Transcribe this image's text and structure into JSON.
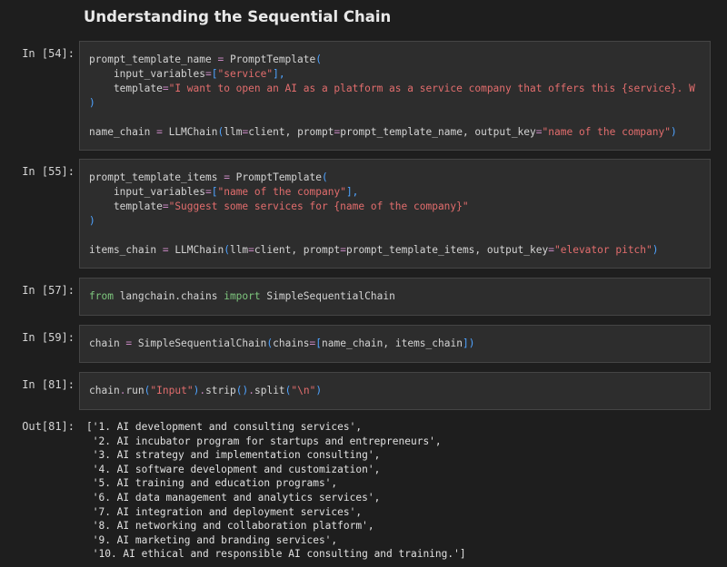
{
  "notebook": {
    "heading": "Understanding the Sequential Chain",
    "cells": [
      {
        "prompt": "In [54]:",
        "lines": [
          [
            {
              "t": "prompt_template_name ",
              "c": "id"
            },
            {
              "t": "=",
              "c": "op"
            },
            {
              "t": " PromptTemplate",
              "c": "id"
            },
            {
              "t": "(",
              "c": "br"
            }
          ],
          [
            {
              "t": "    input_variables",
              "c": "id"
            },
            {
              "t": "=",
              "c": "op"
            },
            {
              "t": "[",
              "c": "br"
            },
            {
              "t": "\"service\"",
              "c": "str"
            },
            {
              "t": "],",
              "c": "br"
            }
          ],
          [
            {
              "t": "    template",
              "c": "id"
            },
            {
              "t": "=",
              "c": "op"
            },
            {
              "t": "\"I want to open an AI as a platform as a service company that offers this {service}. W",
              "c": "str"
            }
          ],
          [
            {
              "t": ")",
              "c": "br"
            }
          ],
          [],
          [
            {
              "t": "name_chain ",
              "c": "id"
            },
            {
              "t": "=",
              "c": "op"
            },
            {
              "t": " LLMChain",
              "c": "id"
            },
            {
              "t": "(",
              "c": "br"
            },
            {
              "t": "llm",
              "c": "id"
            },
            {
              "t": "=",
              "c": "op"
            },
            {
              "t": "client, prompt",
              "c": "id"
            },
            {
              "t": "=",
              "c": "op"
            },
            {
              "t": "prompt_template_name, output_key",
              "c": "id"
            },
            {
              "t": "=",
              "c": "op"
            },
            {
              "t": "\"name of the company\"",
              "c": "str"
            },
            {
              "t": ")",
              "c": "br"
            }
          ]
        ]
      },
      {
        "prompt": "In [55]:",
        "lines": [
          [
            {
              "t": "prompt_template_items ",
              "c": "id"
            },
            {
              "t": "=",
              "c": "op"
            },
            {
              "t": " PromptTemplate",
              "c": "id"
            },
            {
              "t": "(",
              "c": "br"
            }
          ],
          [
            {
              "t": "    input_variables",
              "c": "id"
            },
            {
              "t": "=",
              "c": "op"
            },
            {
              "t": "[",
              "c": "br"
            },
            {
              "t": "\"name of the company\"",
              "c": "str"
            },
            {
              "t": "],",
              "c": "br"
            }
          ],
          [
            {
              "t": "    template",
              "c": "id"
            },
            {
              "t": "=",
              "c": "op"
            },
            {
              "t": "\"Suggest some services for {name of the company}\"",
              "c": "str"
            }
          ],
          [
            {
              "t": ")",
              "c": "br"
            }
          ],
          [],
          [
            {
              "t": "items_chain ",
              "c": "id"
            },
            {
              "t": "=",
              "c": "op"
            },
            {
              "t": " LLMChain",
              "c": "id"
            },
            {
              "t": "(",
              "c": "br"
            },
            {
              "t": "llm",
              "c": "id"
            },
            {
              "t": "=",
              "c": "op"
            },
            {
              "t": "client, prompt",
              "c": "id"
            },
            {
              "t": "=",
              "c": "op"
            },
            {
              "t": "prompt_template_items, output_key",
              "c": "id"
            },
            {
              "t": "=",
              "c": "op"
            },
            {
              "t": "\"elevator pitch\"",
              "c": "str"
            },
            {
              "t": ")",
              "c": "br"
            }
          ]
        ]
      },
      {
        "prompt": "In [57]:",
        "lines": [
          [
            {
              "t": "from",
              "c": "kw"
            },
            {
              "t": " langchain.chains ",
              "c": "id"
            },
            {
              "t": "import",
              "c": "kw"
            },
            {
              "t": " SimpleSequentialChain",
              "c": "id"
            }
          ]
        ]
      },
      {
        "prompt": "In [59]:",
        "lines": [
          [
            {
              "t": "chain ",
              "c": "id"
            },
            {
              "t": "=",
              "c": "op"
            },
            {
              "t": " SimpleSequentialChain",
              "c": "id"
            },
            {
              "t": "(",
              "c": "br"
            },
            {
              "t": "chains",
              "c": "id"
            },
            {
              "t": "=",
              "c": "op"
            },
            {
              "t": "[",
              "c": "br"
            },
            {
              "t": "name_chain, items_chain",
              "c": "id"
            },
            {
              "t": "])",
              "c": "br"
            }
          ]
        ]
      },
      {
        "prompt": "In [81]:",
        "lines": [
          [
            {
              "t": "chain",
              "c": "id"
            },
            {
              "t": ".",
              "c": "op"
            },
            {
              "t": "run",
              "c": "id"
            },
            {
              "t": "(",
              "c": "br"
            },
            {
              "t": "\"Input\"",
              "c": "str"
            },
            {
              "t": ")",
              "c": "br"
            },
            {
              "t": ".",
              "c": "op"
            },
            {
              "t": "strip",
              "c": "id"
            },
            {
              "t": "()",
              "c": "br"
            },
            {
              "t": ".",
              "c": "op"
            },
            {
              "t": "split",
              "c": "id"
            },
            {
              "t": "(",
              "c": "br"
            },
            {
              "t": "\"\\n\"",
              "c": "str"
            },
            {
              "t": ")",
              "c": "br"
            }
          ]
        ]
      }
    ],
    "output": {
      "prompt": "Out[81]:",
      "lines": [
        "['1. AI development and consulting services',",
        " '2. AI incubator program for startups and entrepreneurs',",
        " '3. AI strategy and implementation consulting',",
        " '4. AI software development and customization',",
        " '5. AI training and education programs',",
        " '6. AI data management and analytics services',",
        " '7. AI integration and deployment services',",
        " '8. AI networking and collaboration platform',",
        " '9. AI marketing and branding services',",
        " '10. AI ethical and responsible AI consulting and training.']"
      ]
    }
  }
}
